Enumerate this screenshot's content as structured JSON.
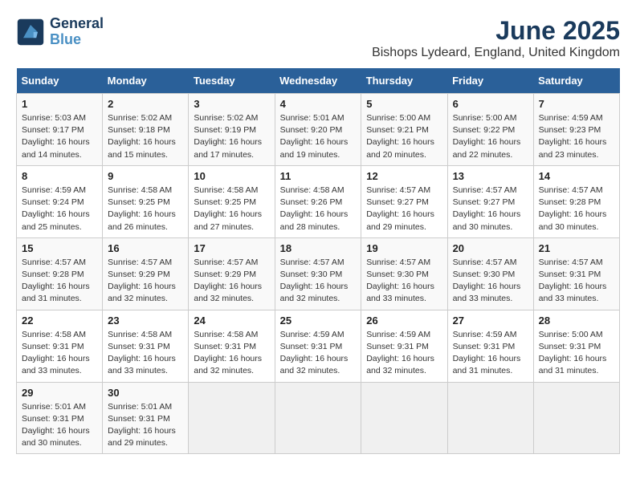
{
  "header": {
    "logo_line1": "General",
    "logo_line2": "Blue",
    "title": "June 2025",
    "subtitle": "Bishops Lydeard, England, United Kingdom"
  },
  "days_of_week": [
    "Sunday",
    "Monday",
    "Tuesday",
    "Wednesday",
    "Thursday",
    "Friday",
    "Saturday"
  ],
  "weeks": [
    [
      {
        "day": 1,
        "info": "Sunrise: 5:03 AM\nSunset: 9:17 PM\nDaylight: 16 hours\nand 14 minutes."
      },
      {
        "day": 2,
        "info": "Sunrise: 5:02 AM\nSunset: 9:18 PM\nDaylight: 16 hours\nand 15 minutes."
      },
      {
        "day": 3,
        "info": "Sunrise: 5:02 AM\nSunset: 9:19 PM\nDaylight: 16 hours\nand 17 minutes."
      },
      {
        "day": 4,
        "info": "Sunrise: 5:01 AM\nSunset: 9:20 PM\nDaylight: 16 hours\nand 19 minutes."
      },
      {
        "day": 5,
        "info": "Sunrise: 5:00 AM\nSunset: 9:21 PM\nDaylight: 16 hours\nand 20 minutes."
      },
      {
        "day": 6,
        "info": "Sunrise: 5:00 AM\nSunset: 9:22 PM\nDaylight: 16 hours\nand 22 minutes."
      },
      {
        "day": 7,
        "info": "Sunrise: 4:59 AM\nSunset: 9:23 PM\nDaylight: 16 hours\nand 23 minutes."
      }
    ],
    [
      {
        "day": 8,
        "info": "Sunrise: 4:59 AM\nSunset: 9:24 PM\nDaylight: 16 hours\nand 25 minutes."
      },
      {
        "day": 9,
        "info": "Sunrise: 4:58 AM\nSunset: 9:25 PM\nDaylight: 16 hours\nand 26 minutes."
      },
      {
        "day": 10,
        "info": "Sunrise: 4:58 AM\nSunset: 9:25 PM\nDaylight: 16 hours\nand 27 minutes."
      },
      {
        "day": 11,
        "info": "Sunrise: 4:58 AM\nSunset: 9:26 PM\nDaylight: 16 hours\nand 28 minutes."
      },
      {
        "day": 12,
        "info": "Sunrise: 4:57 AM\nSunset: 9:27 PM\nDaylight: 16 hours\nand 29 minutes."
      },
      {
        "day": 13,
        "info": "Sunrise: 4:57 AM\nSunset: 9:27 PM\nDaylight: 16 hours\nand 30 minutes."
      },
      {
        "day": 14,
        "info": "Sunrise: 4:57 AM\nSunset: 9:28 PM\nDaylight: 16 hours\nand 30 minutes."
      }
    ],
    [
      {
        "day": 15,
        "info": "Sunrise: 4:57 AM\nSunset: 9:28 PM\nDaylight: 16 hours\nand 31 minutes."
      },
      {
        "day": 16,
        "info": "Sunrise: 4:57 AM\nSunset: 9:29 PM\nDaylight: 16 hours\nand 32 minutes."
      },
      {
        "day": 17,
        "info": "Sunrise: 4:57 AM\nSunset: 9:29 PM\nDaylight: 16 hours\nand 32 minutes."
      },
      {
        "day": 18,
        "info": "Sunrise: 4:57 AM\nSunset: 9:30 PM\nDaylight: 16 hours\nand 32 minutes."
      },
      {
        "day": 19,
        "info": "Sunrise: 4:57 AM\nSunset: 9:30 PM\nDaylight: 16 hours\nand 33 minutes."
      },
      {
        "day": 20,
        "info": "Sunrise: 4:57 AM\nSunset: 9:30 PM\nDaylight: 16 hours\nand 33 minutes."
      },
      {
        "day": 21,
        "info": "Sunrise: 4:57 AM\nSunset: 9:31 PM\nDaylight: 16 hours\nand 33 minutes."
      }
    ],
    [
      {
        "day": 22,
        "info": "Sunrise: 4:58 AM\nSunset: 9:31 PM\nDaylight: 16 hours\nand 33 minutes."
      },
      {
        "day": 23,
        "info": "Sunrise: 4:58 AM\nSunset: 9:31 PM\nDaylight: 16 hours\nand 33 minutes."
      },
      {
        "day": 24,
        "info": "Sunrise: 4:58 AM\nSunset: 9:31 PM\nDaylight: 16 hours\nand 32 minutes."
      },
      {
        "day": 25,
        "info": "Sunrise: 4:59 AM\nSunset: 9:31 PM\nDaylight: 16 hours\nand 32 minutes."
      },
      {
        "day": 26,
        "info": "Sunrise: 4:59 AM\nSunset: 9:31 PM\nDaylight: 16 hours\nand 32 minutes."
      },
      {
        "day": 27,
        "info": "Sunrise: 4:59 AM\nSunset: 9:31 PM\nDaylight: 16 hours\nand 31 minutes."
      },
      {
        "day": 28,
        "info": "Sunrise: 5:00 AM\nSunset: 9:31 PM\nDaylight: 16 hours\nand 31 minutes."
      }
    ],
    [
      {
        "day": 29,
        "info": "Sunrise: 5:01 AM\nSunset: 9:31 PM\nDaylight: 16 hours\nand 30 minutes."
      },
      {
        "day": 30,
        "info": "Sunrise: 5:01 AM\nSunset: 9:31 PM\nDaylight: 16 hours\nand 29 minutes."
      },
      null,
      null,
      null,
      null,
      null
    ]
  ]
}
